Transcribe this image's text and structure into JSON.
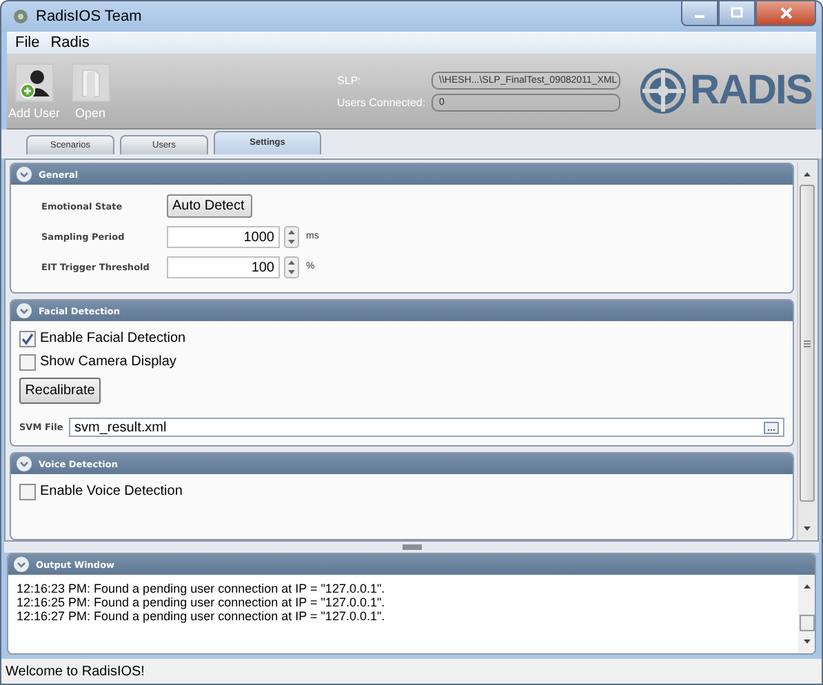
{
  "window": {
    "title": "RadisIOS Team"
  },
  "menu": [
    "File",
    "Radis"
  ],
  "toolbar": [
    {
      "label": "Add User",
      "kind": "add-user"
    },
    {
      "label": "Open",
      "kind": "open"
    }
  ],
  "slp": {
    "label": "SLP:",
    "value": "\\\\HESH...\\SLP_FinalTest_09082011_XML"
  },
  "users_connected": {
    "label": "Users Connected:",
    "value": "0"
  },
  "logo": "RADIS",
  "tabs": [
    {
      "label": "Scenarios",
      "selected": false
    },
    {
      "label": "Users",
      "selected": false
    },
    {
      "label": "Settings",
      "selected": true
    }
  ],
  "sections": [
    {
      "title": "General",
      "expanded": true,
      "items": [
        {
          "kind": "dropdown",
          "label": "Emotional State",
          "value": "Auto Detect"
        },
        {
          "kind": "spinner",
          "label": "Sampling Period",
          "value": "1000",
          "unit": "ms"
        },
        {
          "kind": "spinner",
          "label": "EIT Trigger Threshold",
          "value": "100",
          "unit": "%"
        }
      ]
    },
    {
      "title": "Facial Detection",
      "expanded": true,
      "items": [
        {
          "kind": "checkbox",
          "label": "Enable Facial Detection",
          "checked": true
        },
        {
          "kind": "checkbox",
          "label": "Show Camera Display",
          "checked": false
        },
        {
          "kind": "button",
          "label": "Recalibrate"
        },
        {
          "kind": "file",
          "label": "SVM File",
          "value": "svm_result.xml"
        }
      ]
    },
    {
      "title": "Voice Detection",
      "expanded": true,
      "items": [
        {
          "kind": "checkbox",
          "label": "Enable Voice Detection",
          "checked": false
        }
      ]
    }
  ],
  "output": {
    "title": "Output Window",
    "lines": [
      "12:16:23 PM: Found a pending user connection at IP = \"127.0.0.1\".",
      "12:16:25 PM: Found a pending user connection at IP = \"127.0.0.1\".",
      "12:16:27 PM: Found a pending user connection at IP = \"127.0.0.1\"."
    ]
  },
  "status_bar": "Welcome to RadisIOS!"
}
